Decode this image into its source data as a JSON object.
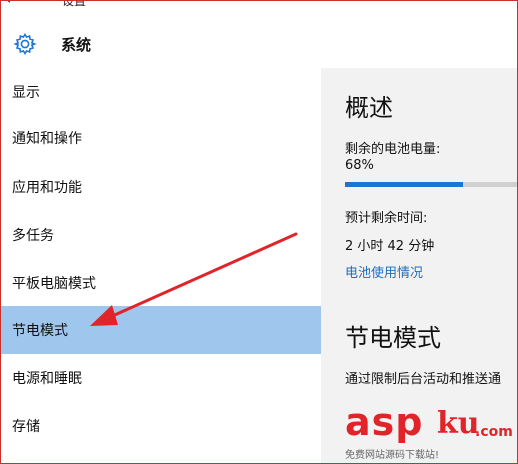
{
  "header": {
    "back_glyph": "←",
    "settings_title": "设置",
    "section_title": "系统"
  },
  "sidebar": {
    "items": [
      {
        "label": "显示",
        "selected": false
      },
      {
        "label": "通知和操作",
        "selected": false
      },
      {
        "label": "应用和功能",
        "selected": false
      },
      {
        "label": "多任务",
        "selected": false
      },
      {
        "label": "平板电脑模式",
        "selected": false
      },
      {
        "label": "节电模式",
        "selected": true
      },
      {
        "label": "电源和睡眠",
        "selected": false
      },
      {
        "label": "存储",
        "selected": false
      }
    ]
  },
  "content": {
    "overview_heading": "概述",
    "battery_label": "剩余的电池电量:",
    "battery_value": "68%",
    "battery_fraction": 0.68,
    "remaining_label": "预计剩余时间:",
    "remaining_value": "2 小时 42 分钟",
    "usage_link": "电池使用情况",
    "saver_heading": "节电模式",
    "saver_description": "通过限制后台活动和推送通"
  },
  "watermark": {
    "brand_asp": "asp",
    "brand_ku": "ku",
    "brand_com": ".com",
    "subtitle": "免费网站源码下载站!"
  },
  "colors": {
    "selected_bg": "#9fc6ec",
    "accent_blue": "#1e74d4",
    "link_blue": "#1a6fc0",
    "annotation_red": "#e0242a",
    "content_bg": "#f2f2f2"
  },
  "icons": {
    "gear": "gear-icon",
    "back": "back-arrow-icon"
  }
}
